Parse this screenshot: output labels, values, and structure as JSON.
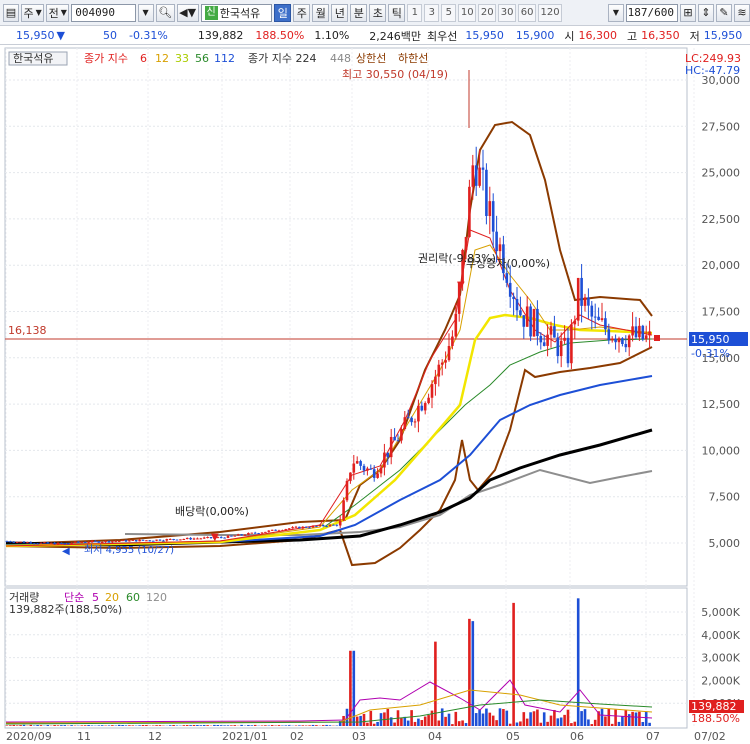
{
  "toolbar": {
    "type_label": "주",
    "market_label": "전",
    "code": "004090",
    "stock_name": "한국석유",
    "new_badge": "신",
    "periods": [
      "일",
      "주",
      "월",
      "년",
      "분",
      "초",
      "틱"
    ],
    "active_period": "일",
    "intervals": [
      "1",
      "3",
      "5",
      "10",
      "20",
      "30",
      "60",
      "120"
    ],
    "count": "187/600"
  },
  "quote": {
    "price": "15,950",
    "direction": "▼",
    "change": "50",
    "change_pct": "-0.31%",
    "volume": "139,882",
    "volume_ratio": "188.50%",
    "turnover_pct": "1.10%",
    "amount": "2,246백만",
    "best_bid_label": "최우선",
    "ask": "15,950",
    "bid": "15,900",
    "open_label": "시",
    "open": "16,300",
    "high_label": "고",
    "high": "16,350",
    "low_label": "저",
    "low": "15,950"
  },
  "legend": {
    "stock": "한국석유",
    "ma_label": "종가 지수",
    "ma_periods": [
      "6",
      "12",
      "33",
      "56",
      "112"
    ],
    "ma_colors": [
      "#e0201f",
      "#d8a000",
      "#aacc00",
      "#2a8a2a",
      "#1d4fd6"
    ],
    "env_label": "종가 지수 224",
    "env_value": "448",
    "limit_up": "상한선",
    "limit_down": "하한선",
    "lc": "LC:249.93",
    "hc": "HC:-47.79"
  },
  "annotations": {
    "high": "최고 30,550 (04/19)",
    "low": "최저 4,955 (10/27)",
    "dividend": "배당락(0,00%)",
    "rights": "권리락(-9.83%)",
    "bonus": "무상증자(0,00%)",
    "ref_line": "16,138",
    "last_price": "15,950",
    "last_pct": "-0.31%"
  },
  "volume_panel": {
    "label": "거래량",
    "ma_label": "단순",
    "ma_periods": [
      "5",
      "20",
      "60",
      "120"
    ],
    "summary": "139,882주(188,50%)",
    "last_value": "139,882",
    "last_pct": "188.50%"
  },
  "chart_data": {
    "type": "candlestick",
    "price_axis_ticks": [
      "30,000",
      "27,500",
      "25,000",
      "22,500",
      "20,000",
      "17,500",
      "15,000",
      "12,500",
      "10,000",
      "7,500",
      "5,000"
    ],
    "price_axis_values": [
      30000,
      27500,
      25000,
      22500,
      20000,
      17500,
      15000,
      12500,
      10000,
      7500,
      5000
    ],
    "volume_axis_ticks": [
      "5,000K",
      "4,000K",
      "3,000K",
      "2,000K",
      "1,000K"
    ],
    "volume_axis_values": [
      5000,
      4000,
      3000,
      2000,
      1000
    ],
    "date_ticks": [
      "2020/09",
      "11",
      "12",
      "2021/01",
      "02",
      "03",
      "04",
      "05",
      "06",
      "07",
      "07/02"
    ],
    "close_series": [
      [
        "2020/09",
        5100
      ],
      [
        "2020/10",
        5000
      ],
      [
        "2020/10/27",
        4955
      ],
      [
        "2020/11",
        5050
      ],
      [
        "2020/12",
        5150
      ],
      [
        "2021/01",
        5300
      ],
      [
        "2021/02",
        5800
      ],
      [
        "2021/02/25",
        6000
      ],
      [
        "2021/03/05",
        9500
      ],
      [
        "2021/03/15",
        8800
      ],
      [
        "2021/03/25",
        10500
      ],
      [
        "2021/04/01",
        12500
      ],
      [
        "2021/04/08",
        14500
      ],
      [
        "2021/04/12",
        16500
      ],
      [
        "2021/04/15",
        24000
      ],
      [
        "2021/04/19",
        26000
      ],
      [
        "2021/04/26",
        22500
      ],
      [
        "2021/05/03",
        20000
      ],
      [
        "2021/05/10",
        17500
      ],
      [
        "2021/05/20",
        16500
      ],
      [
        "2021/05/31",
        15200
      ],
      [
        "2021/06/03",
        18500
      ],
      [
        "2021/06/10",
        16800
      ],
      [
        "2021/06/20",
        16300
      ],
      [
        "2021/06/30",
        16000
      ],
      [
        "2021/07/02",
        15950
      ]
    ],
    "volume_series": [
      [
        "2021/03/05",
        3300
      ],
      [
        "2021/04/08",
        3700
      ],
      [
        "2021/04/15",
        4700
      ],
      [
        "2021/04/19",
        4600
      ],
      [
        "2021/05/03",
        5400
      ],
      [
        "2021/06/03",
        5600
      ],
      [
        "2021/07/02",
        140
      ]
    ],
    "reference_line": 16138
  }
}
